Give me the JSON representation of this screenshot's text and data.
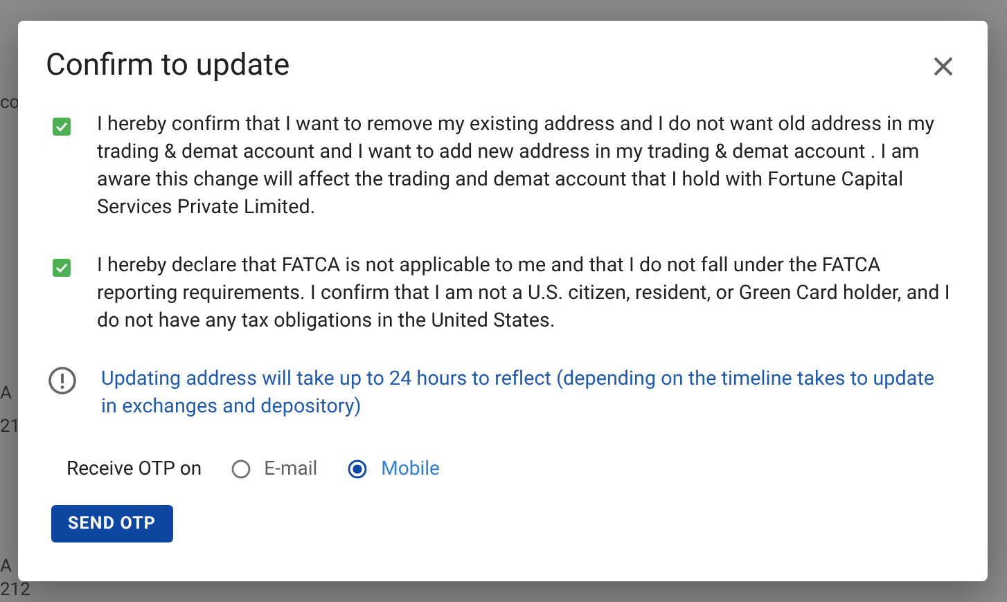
{
  "background_fragments": [
    "co",
    "A",
    "21",
    "A",
    "212"
  ],
  "dialog": {
    "title": "Confirm to update",
    "consents": [
      {
        "checked": true,
        "text": "I hereby confirm that I want to remove my existing address and I do not want old address in my trading & demat account and I want to add new address in my trading & demat account . I am aware this change will affect the trading and demat account that I hold with Fortune Capital Services Private Limited."
      },
      {
        "checked": true,
        "text": "I hereby declare that FATCA is not applicable to me and that I do not fall under the FATCA reporting requirements. I confirm that I am not a U.S. citizen, resident, or Green Card holder, and I do not have any tax obligations in the United States."
      }
    ],
    "notice": "Updating address will take up to 24 hours to reflect (depending on the timeline takes to update in exchanges and depository)",
    "otp_label": "Receive OTP on",
    "otp_options": [
      {
        "label": "E-mail",
        "selected": false
      },
      {
        "label": "Mobile",
        "selected": true
      }
    ],
    "button": "SEND OTP"
  }
}
